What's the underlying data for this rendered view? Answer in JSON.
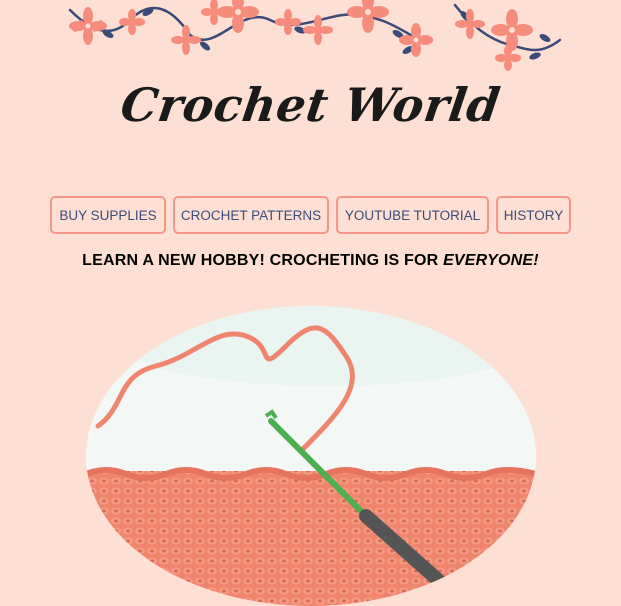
{
  "site": {
    "title": "Crochet World"
  },
  "nav": {
    "items": [
      {
        "label": "BUY SUPPLIES"
      },
      {
        "label": "CROCHET PATTERNS"
      },
      {
        "label": "YOUTUBE TUTORIAL"
      },
      {
        "label": "HISTORY"
      }
    ]
  },
  "tagline": {
    "text": "LEARN A NEW HOBBY! CROCHETING IS FOR ",
    "emphasis": "EVERYONE!"
  },
  "colors": {
    "background": "#fde0d3",
    "nav_border": "#f4978a",
    "nav_text": "#3d4c7a",
    "flower": "#f68c7c",
    "vine": "#3b4a7a",
    "yarn": "#f0856d",
    "hook": "#4caf50"
  },
  "icons": {
    "banner": "flower-vine-icon",
    "hero": "crochet-hook-yarn-image"
  }
}
